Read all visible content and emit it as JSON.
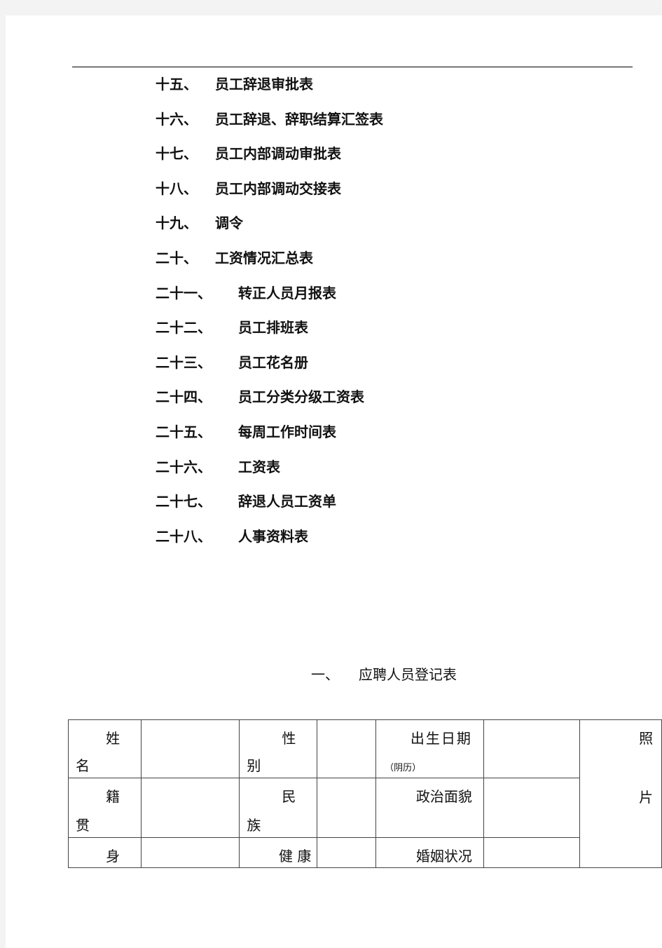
{
  "toc": [
    {
      "num": "十五、",
      "title": "员工辞退审批表"
    },
    {
      "num": "十六、",
      "title": "员工辞退、辞职结算汇签表"
    },
    {
      "num": "十七、",
      "title": "员工内部调动审批表"
    },
    {
      "num": "十八、",
      "title": "员工内部调动交接表"
    },
    {
      "num": "十九、",
      "title": "调令"
    },
    {
      "num": "二十、",
      "title": "工资情况汇总表"
    },
    {
      "num": "二十一、",
      "title": "转正人员月报表"
    },
    {
      "num": "二十二、",
      "title": "员工排班表"
    },
    {
      "num": "二十三、",
      "title": "员工花名册"
    },
    {
      "num": "二十四、",
      "title": "员工分类分级工资表"
    },
    {
      "num": "二十五、",
      "title": "每周工作时间表"
    },
    {
      "num": "二十六、",
      "title": "工资表"
    },
    {
      "num": "二十七、",
      "title": "辞退人员工资单"
    },
    {
      "num": "二十八、",
      "title": "人事资料表"
    }
  ],
  "section": {
    "num": "一、",
    "title": "应聘人员登记表"
  },
  "form": {
    "name_a": "姓",
    "name_b": "名",
    "gender_a": "性",
    "gender_b": "别",
    "birth": "出生日期",
    "birth_note": "（阴历）",
    "photo_a": "照",
    "photo_b": "片",
    "native_a": "籍",
    "native_b": "贯",
    "ethnic_a": "民",
    "ethnic_b": "族",
    "political": "政治面貌",
    "id_a": "身",
    "health": "健 康",
    "marital": "婚姻状况"
  }
}
